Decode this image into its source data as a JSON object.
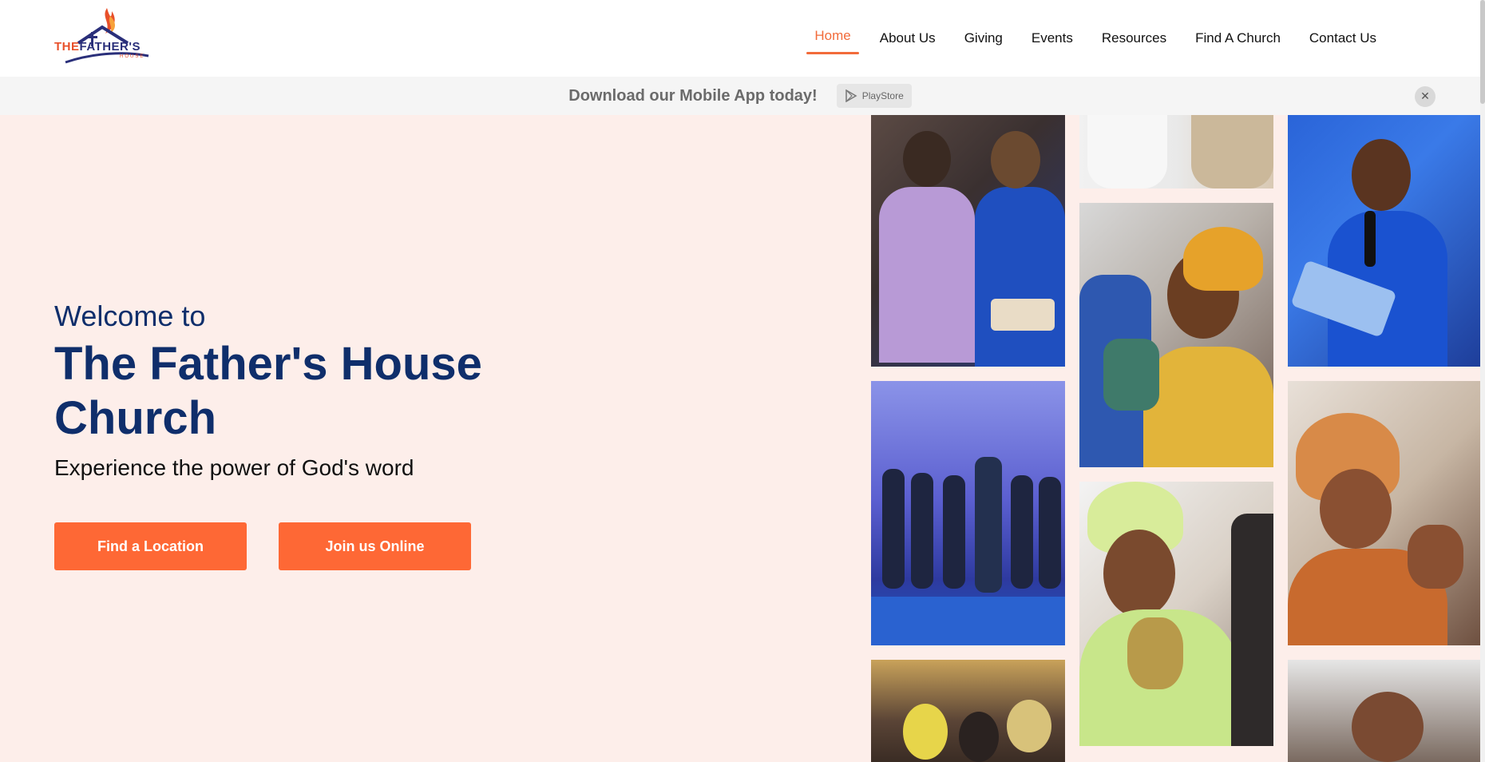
{
  "header": {
    "logo": {
      "name": "The Father's House logo",
      "text_the": "THE",
      "text_main": "FATHER'S",
      "text_sub": "HOUSE",
      "colors": {
        "flame": "#e8502a",
        "house": "#2a2f7a"
      }
    },
    "nav": [
      {
        "label": "Home",
        "active": true
      },
      {
        "label": "About Us",
        "active": false
      },
      {
        "label": "Giving",
        "active": false
      },
      {
        "label": "Events",
        "active": false
      },
      {
        "label": "Resources",
        "active": false
      },
      {
        "label": "Find A Church",
        "active": false
      },
      {
        "label": "Contact Us",
        "active": false
      }
    ]
  },
  "banner": {
    "text": "Download our Mobile App today!",
    "store_label": "PlayStore",
    "store_icon": "play-store-icon",
    "close_icon": "close-icon"
  },
  "hero": {
    "welcome": "Welcome to",
    "title": "The Father's House Church",
    "tagline": "Experience the power of God's word",
    "buttons": {
      "find_location": "Find a Location",
      "join_online": "Join us Online"
    }
  },
  "gallery": {
    "photos": [
      {
        "name": "gallery-photo-congregation-couple"
      },
      {
        "name": "gallery-photo-hands-clapping"
      },
      {
        "name": "gallery-photo-pastor-preaching"
      },
      {
        "name": "gallery-photo-woman-headwrap-yellow"
      },
      {
        "name": "gallery-photo-choir-stage"
      },
      {
        "name": "gallery-photo-woman-green-dancing"
      },
      {
        "name": "gallery-photo-woman-orange-gele"
      },
      {
        "name": "gallery-photo-congregation-worship"
      },
      {
        "name": "gallery-photo-man-smiling"
      }
    ]
  },
  "colors": {
    "accent": "#fe6835",
    "nav_active": "#f26b3a",
    "title_blue": "#0f2e6b",
    "hero_bg": "#fdeeea",
    "banner_bg": "#f5f5f5"
  }
}
